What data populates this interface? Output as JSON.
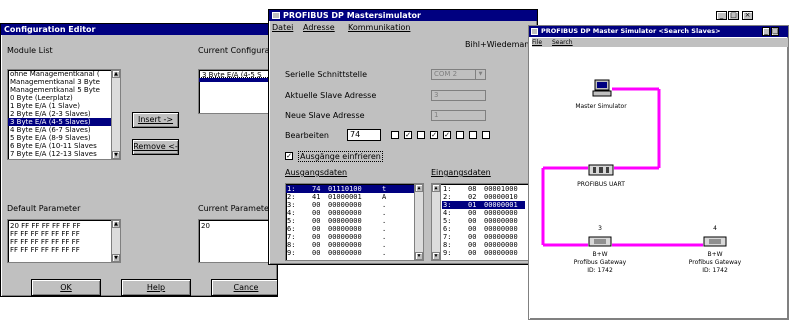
{
  "config_editor": {
    "title": "Configuration Editor",
    "module_list_label": "Module List",
    "current_config_label": "Current Configurati",
    "modules": [
      "ohne Managementkanal (",
      "Managementkanal 3 Byte",
      "Managementkanal 5 Byte",
      "0 Byte (Leerplatz)",
      "1 Byte E/A (1 Slave)",
      "2 Byte E/A (2-3 Slaves)",
      "3 Byte E/A (4-5 Slaves)",
      "4 Byte E/A (6-7 Slaves)",
      "5 Byte E/A (8-9 Slaves)",
      "6 Byte E/A (10-11 Slaves",
      "7 Byte E/A (12-13 Slaves"
    ],
    "selected_module_index": 6,
    "current_config_items": [
      "3 Byte E/A (4-5 S"
    ],
    "insert_label": "Insert ->",
    "remove_label": "Remove <-",
    "default_param_label": "Default Parameter",
    "current_param_label": "Current Parameter",
    "default_params": [
      "20 FF FF FF FF FF FF",
      "FF FF FF FF FF FF FF",
      "FF FF FF FF FF FF FF",
      "FF FF FF FF FF FF FF"
    ],
    "current_param_value": "20",
    "ok_label": "OK",
    "help_label": "Help",
    "cancel_label": "Cance"
  },
  "profibus_master": {
    "title": "PROFIBUS DP Mastersimulator",
    "menu": [
      "Datei",
      "Adresse",
      "Kommunikation"
    ],
    "company": "Bihl+Wiedemann Gm",
    "serial_label": "Serielle Schnittstelle",
    "serial_value": "COM 2",
    "current_slave_label": "Aktuelle Slave Adresse",
    "current_slave_value": "3",
    "new_slave_label": "Neue Slave Adresse",
    "new_slave_value": "1",
    "edit_label": "Bearbeiten",
    "edit_value": "74",
    "bit_checks": [
      false,
      true,
      false,
      true,
      true,
      false,
      false,
      false
    ],
    "outputs_enable_label": "Ausgänge einfrieren",
    "outputs_enable_checked": true,
    "output_data_label": "Ausgangsdaten",
    "input_data_label": "Eingangsdaten",
    "output_rows": [
      {
        "idx": "1:",
        "dec": "74",
        "bin": "01110100",
        "ch": "t"
      },
      {
        "idx": "2:",
        "dec": "41",
        "bin": "01000001",
        "ch": "A"
      },
      {
        "idx": "3:",
        "dec": "00",
        "bin": "00000000",
        "ch": "."
      },
      {
        "idx": "4:",
        "dec": "00",
        "bin": "00000000",
        "ch": "."
      },
      {
        "idx": "5:",
        "dec": "00",
        "bin": "00000000",
        "ch": "."
      },
      {
        "idx": "6:",
        "dec": "00",
        "bin": "00000000",
        "ch": "."
      },
      {
        "idx": "7:",
        "dec": "00",
        "bin": "00000000",
        "ch": "."
      },
      {
        "idx": "8:",
        "dec": "00",
        "bin": "00000000",
        "ch": "."
      },
      {
        "idx": "9:",
        "dec": "00",
        "bin": "00000000",
        "ch": "."
      }
    ],
    "selected_output_row": 0,
    "input_rows": [
      {
        "idx": "1:",
        "dec": "08",
        "bin": "00001000"
      },
      {
        "idx": "2:",
        "dec": "02",
        "bin": "00000010"
      },
      {
        "idx": "3:",
        "dec": "01",
        "bin": "00000001"
      },
      {
        "idx": "4:",
        "dec": "00",
        "bin": "00000000"
      },
      {
        "idx": "5:",
        "dec": "00",
        "bin": "00000000"
      },
      {
        "idx": "6:",
        "dec": "00",
        "bin": "00000000"
      },
      {
        "idx": "7:",
        "dec": "00",
        "bin": "00000000"
      },
      {
        "idx": "8:",
        "dec": "00",
        "bin": "00000000"
      },
      {
        "idx": "9:",
        "dec": "00",
        "bin": "00000000"
      }
    ],
    "selected_input_row": 2
  },
  "search_slaves": {
    "title": "PROFIBUS DP Master Simulator <Search Slaves>",
    "menu": [
      "File",
      "Search"
    ],
    "master_label": "Master Simulator",
    "uart_label": "PROFIBUS UART",
    "gateways": [
      {
        "address": "3",
        "name": "B+W",
        "type": "Profibus Gateway",
        "id": "ID: 1742"
      },
      {
        "address": "4",
        "name": "B+W",
        "type": "Profibus Gateway",
        "id": "ID: 1742"
      }
    ],
    "bus_color": "#ff00ff"
  },
  "title_colors": {
    "active": "#000080",
    "inactive": "#808080"
  }
}
